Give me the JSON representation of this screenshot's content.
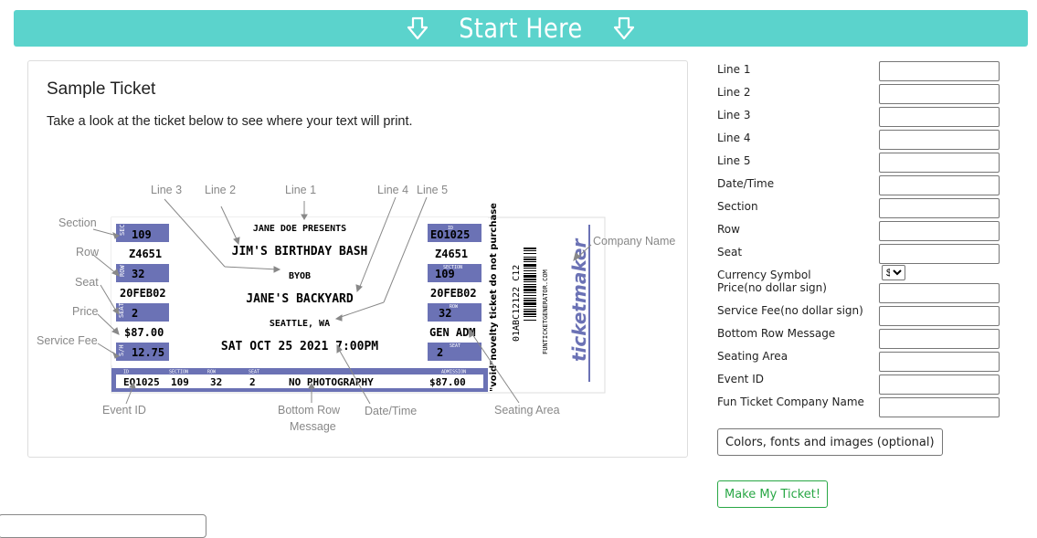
{
  "banner": {
    "title": "Start Here",
    "arrow_icon": "down-arrow-icon"
  },
  "sample": {
    "heading": "Sample Ticket",
    "description": "Take a look at the ticket below to see where your text will print."
  },
  "ticket": {
    "line1": "JANE DOE PRESENTS",
    "line2": "JIM'S BIRTHDAY BASH",
    "line3": "BYOB",
    "line4": "JANE'S BACKYARD",
    "line5": "SEATTLE, WA",
    "datetime": "SAT OCT 25 2021 7:00PM",
    "stub_left": {
      "sec_tag": "SEC",
      "section": "109",
      "event_id": "Z4651",
      "row_tag": "ROW",
      "row": "32",
      "date": "20FEB02",
      "seat_tag": "SEAT",
      "seat": "2",
      "price": "$87.00",
      "fee_tag": "S/H",
      "fee": "12.75"
    },
    "stub_right": {
      "id_tag": "ID",
      "id": "EO1025",
      "event_id": "Z4651",
      "section_tag": "SECTION",
      "section": "109",
      "date": "20FEB02",
      "row_tag": "ROW",
      "row": "32",
      "area": "GEN ADM",
      "seat_tag": "SEAT",
      "seat": "2"
    },
    "bottom": {
      "id_tag": "ID",
      "section_tag": "SECTION",
      "row_tag": "ROW",
      "seat_tag": "SEAT",
      "admission_tag": "ADMISSION",
      "id": "EO1025",
      "section": "109",
      "row": "32",
      "seat": "2",
      "message": "NO PHOTOGRAPHY",
      "price": "$87.00"
    },
    "void_text": "\"void\"novelty ticket do not purchase",
    "barcode_number": "01ABC12122 C12",
    "site_text": "FUNTICKETGENERATOR.COM",
    "brand": "ticketmaker"
  },
  "annotations": {
    "line1": "Line 1",
    "line2": "Line 2",
    "line3": "Line 3",
    "line4": "Line 4",
    "line5": "Line 5",
    "section": "Section",
    "row": "Row",
    "seat": "Seat",
    "price": "Price",
    "service_fee": "Service Fee",
    "event_id": "Event ID",
    "bottom_row_message_1": "Bottom Row",
    "bottom_row_message_2": "Message",
    "date_time": "Date/Time",
    "seating_area": "Seating Area",
    "company_name": "Company Name"
  },
  "form": {
    "fields": [
      {
        "label": "Line 1",
        "value": ""
      },
      {
        "label": "Line 2",
        "value": ""
      },
      {
        "label": "Line 3",
        "value": ""
      },
      {
        "label": "Line 4",
        "value": ""
      },
      {
        "label": "Line 5",
        "value": ""
      },
      {
        "label": "Date/Time",
        "value": ""
      },
      {
        "label": "Section",
        "value": ""
      },
      {
        "label": "Row",
        "value": ""
      },
      {
        "label": "Seat",
        "value": ""
      }
    ],
    "currency_label": "Currency Symbol",
    "currency_value": "$",
    "fields2": [
      {
        "label": "Price(no dollar sign)",
        "value": ""
      },
      {
        "label": "Service Fee(no dollar sign)",
        "value": ""
      },
      {
        "label": "Bottom Row Message",
        "value": ""
      },
      {
        "label": "Seating Area",
        "value": ""
      },
      {
        "label": "Event ID",
        "value": ""
      },
      {
        "label": "Fun Ticket Company Name",
        "value": ""
      }
    ],
    "options_button": "Colors, fonts and images (optional)",
    "submit_button": "Make My Ticket!"
  },
  "colors": {
    "banner": "#5bd3cc",
    "stub_blue": "#6b72b5",
    "submit_green": "#28a745",
    "annotation_gray": "#888888"
  }
}
